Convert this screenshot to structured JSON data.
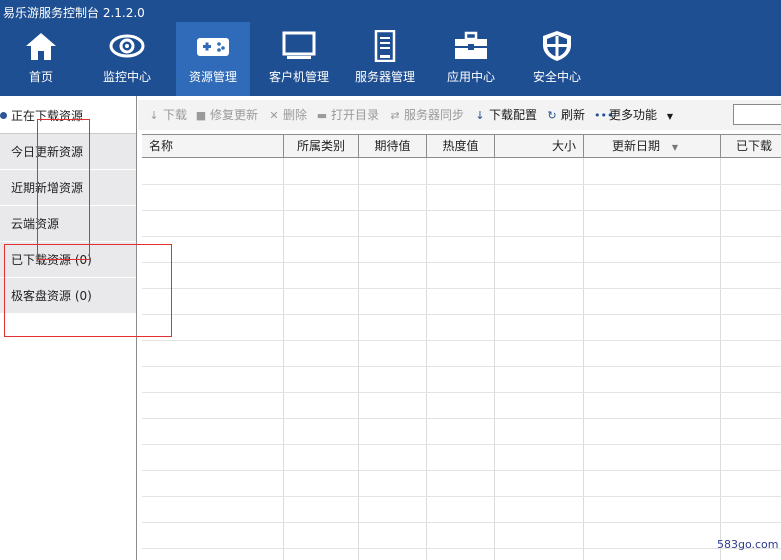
{
  "app": {
    "title": "易乐游服务控制台 2.1.2.0"
  },
  "nav": {
    "items": [
      {
        "label": "首页",
        "icon": "home-icon"
      },
      {
        "label": "监控中心",
        "icon": "eye-icon"
      },
      {
        "label": "资源管理",
        "icon": "gamepad-icon",
        "active": true
      },
      {
        "label": "客户机管理",
        "icon": "monitor-icon"
      },
      {
        "label": "服务器管理",
        "icon": "server-icon"
      },
      {
        "label": "应用中心",
        "icon": "toolbox-icon"
      },
      {
        "label": "安全中心",
        "icon": "shield-icon"
      }
    ]
  },
  "sidebar": {
    "items": [
      {
        "label": "正在下载资源",
        "active": true
      },
      {
        "label": "今日更新资源"
      },
      {
        "label": "近期新增资源"
      },
      {
        "label": "云端资源"
      },
      {
        "label": "已下载资源 (0)"
      },
      {
        "label": "极客盘资源 (0)"
      }
    ]
  },
  "toolbar": {
    "items": [
      {
        "label": "下载",
        "icon": "down-arrow-icon",
        "enabled": false
      },
      {
        "label": "修复更新",
        "icon": "repair-icon",
        "enabled": false
      },
      {
        "label": "删除",
        "icon": "delete-icon",
        "enabled": false
      },
      {
        "label": "打开目录",
        "icon": "folder-icon",
        "enabled": false
      },
      {
        "label": "服务器同步",
        "icon": "sync-icon",
        "enabled": false
      },
      {
        "label": "下载配置",
        "icon": "down-arrow-icon",
        "enabled": true
      },
      {
        "label": "刷新",
        "icon": "refresh-icon",
        "enabled": true
      },
      {
        "label": "更多功能",
        "icon": "more-icon",
        "enabled": true
      }
    ],
    "search_value": ""
  },
  "table": {
    "columns": [
      "名称",
      "所属类别",
      "期待值",
      "热度值",
      "大小",
      "更新日期",
      "已下载"
    ],
    "sorted_column": "更新日期",
    "rows": []
  },
  "colors": {
    "header_bg": "#1f4f93",
    "nav_active_bg": "#2f6bb8",
    "annotation": "#e03030"
  },
  "watermark": "583go.com"
}
